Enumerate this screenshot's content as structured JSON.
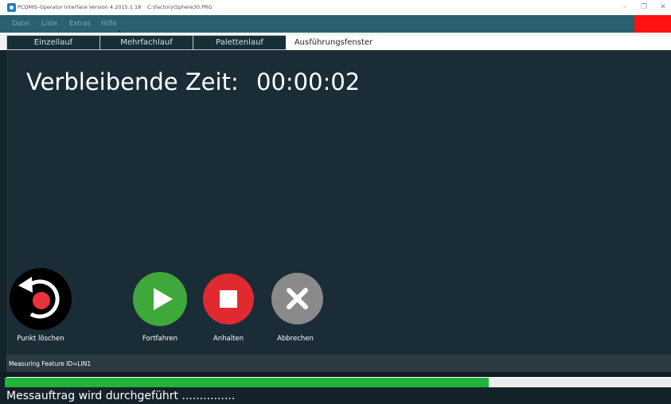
{
  "window": {
    "title": "PCDMIS-Operator Interface  Version 4.2015.1.18",
    "file": "C:\\Factory\\Sphere30.PRG",
    "minimize_glyph": "–",
    "restore_glyph": "❐",
    "close_glyph": "✕"
  },
  "menu": {
    "items": [
      "Datei",
      "Liste",
      "Extras",
      "Hilfe"
    ]
  },
  "tabs": [
    {
      "label": "Einzellauf",
      "active": false
    },
    {
      "label": "Mehrfachlauf",
      "active": false
    },
    {
      "label": "Palettenlauf",
      "active": false
    },
    {
      "label": "Ausführungsfenster",
      "active": true
    }
  ],
  "timer": {
    "label": "Verbleibende Zeit:",
    "value": "00:00:02"
  },
  "buttons": [
    {
      "label": "Punkt löschen",
      "icon": "undo-delete-point-icon",
      "color": "#000000"
    },
    {
      "label": "Fortfahren",
      "icon": "play-icon",
      "color": "#3ea83a"
    },
    {
      "label": "Anhalten",
      "icon": "stop-icon",
      "color": "#e02a2f"
    },
    {
      "label": "Abbrechen",
      "icon": "cancel-x-icon",
      "color": "#8a8a8a"
    }
  ],
  "status": {
    "feature": "Measuring Feature ID=LIN1",
    "progress_fraction": 0.727,
    "message": "Messauftrag wird durchgeführt ..............."
  },
  "colors": {
    "menubar": "#2a6070",
    "background": "#1a2d36",
    "progress": "#22b33c",
    "alert": "#ff1212"
  }
}
